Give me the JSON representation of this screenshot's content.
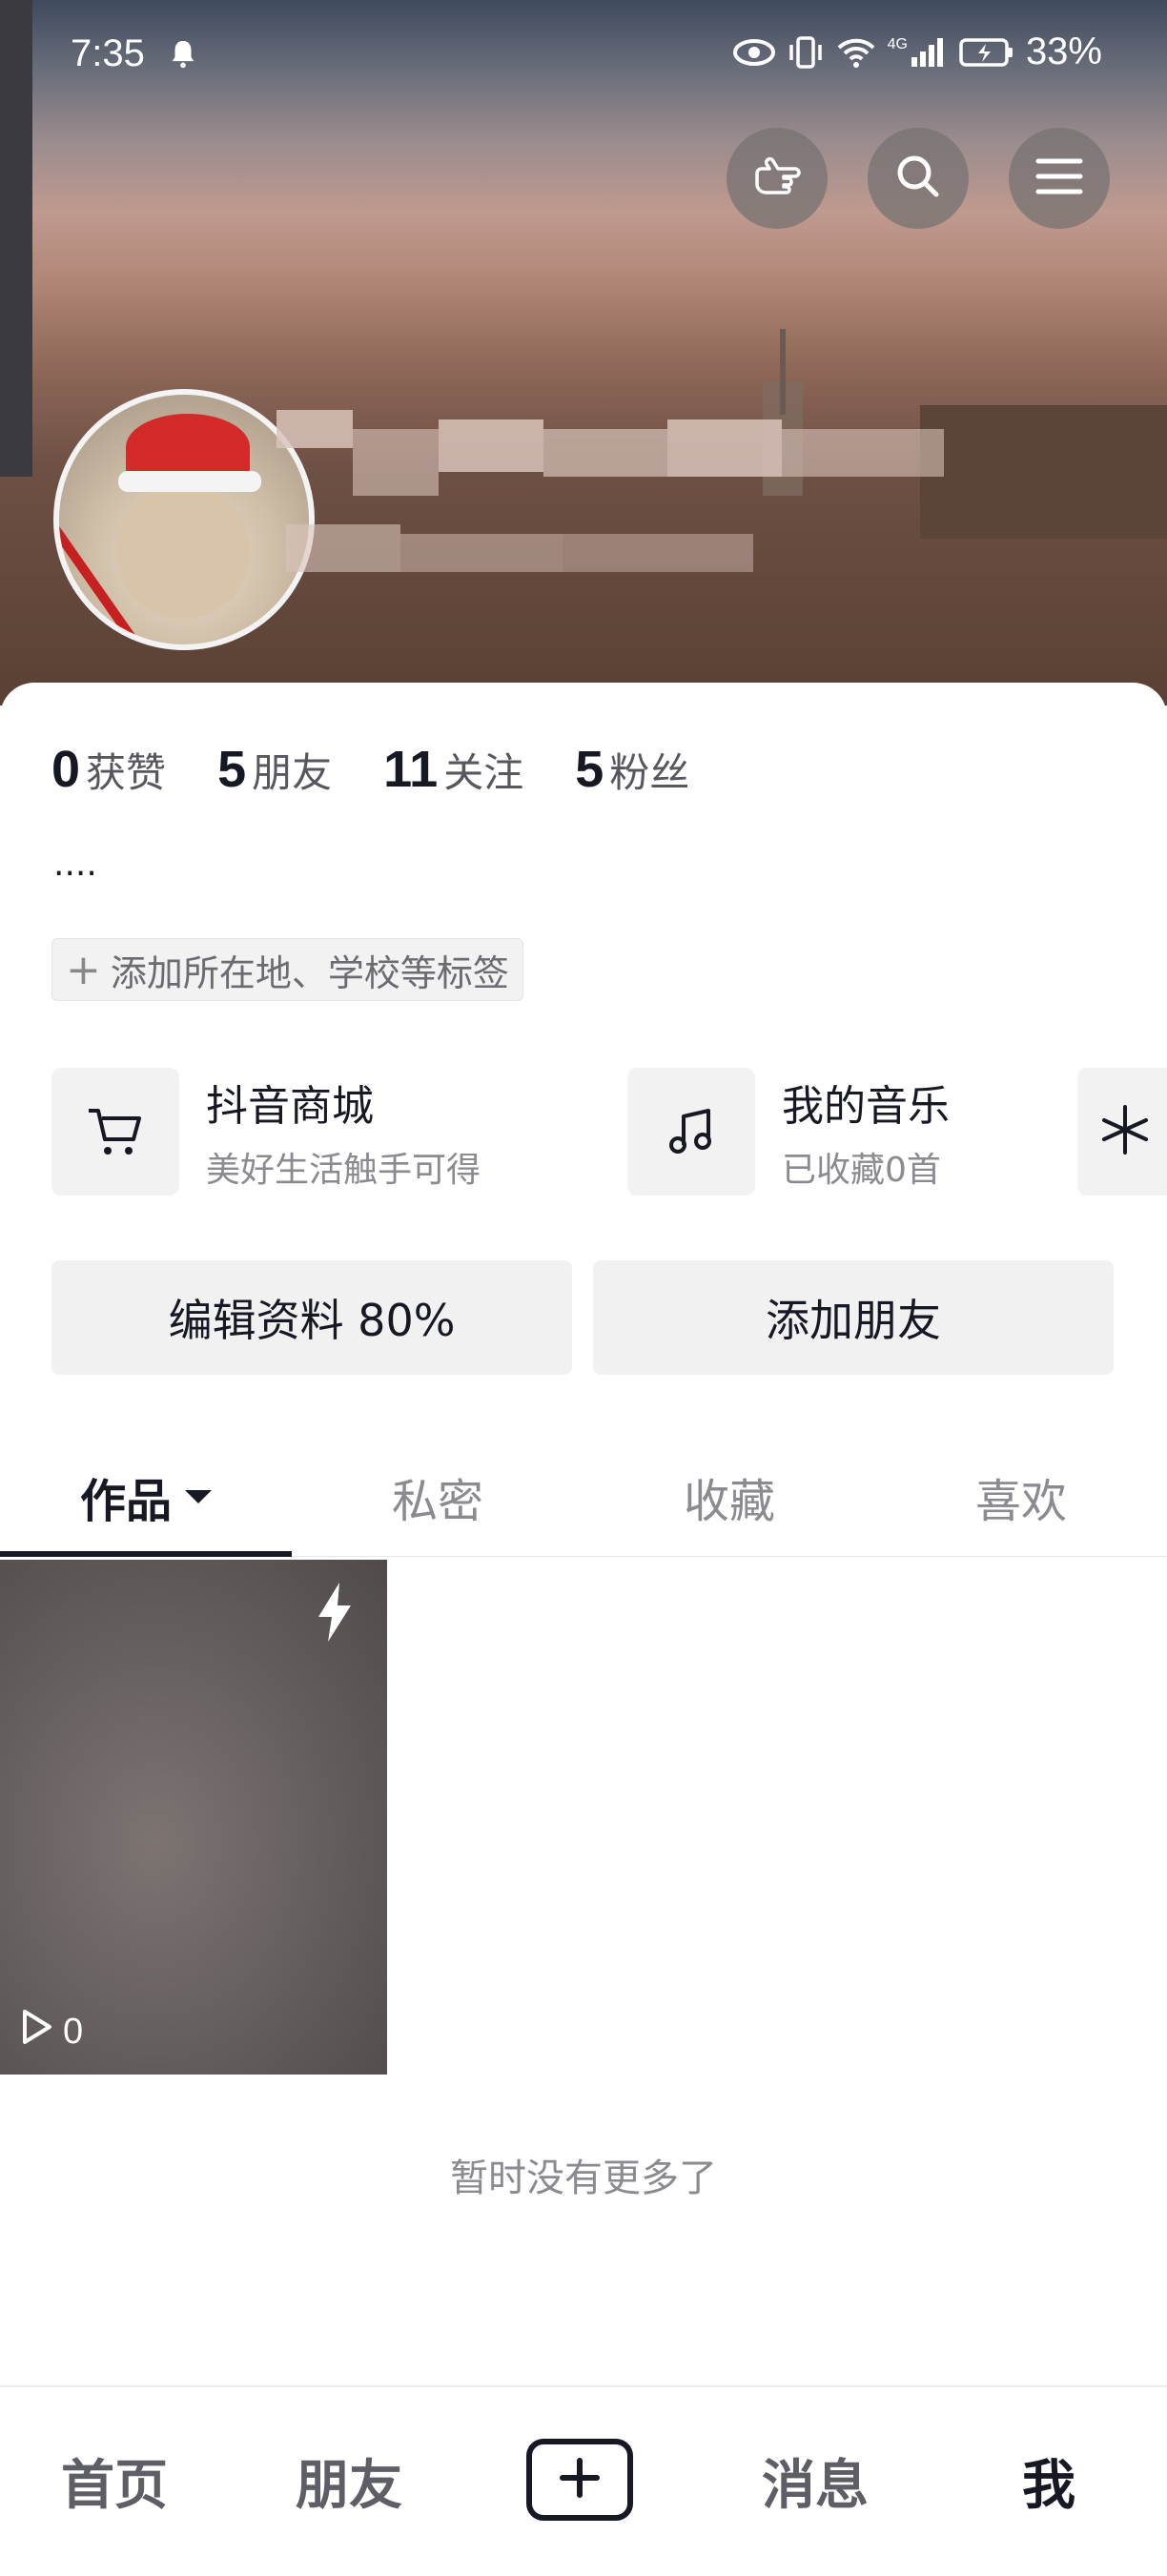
{
  "status_bar": {
    "time": "7:35",
    "network": "4G",
    "battery": "33%"
  },
  "header_actions": [
    {
      "name": "hand-pointer-icon"
    },
    {
      "name": "search-icon"
    },
    {
      "name": "menu-icon"
    }
  ],
  "profile": {
    "stats": [
      {
        "num": "0",
        "label": "获赞"
      },
      {
        "num": "5",
        "label": "朋友"
      },
      {
        "num": "11",
        "label": "关注"
      },
      {
        "num": "5",
        "label": "粉丝"
      }
    ],
    "bio": "....",
    "add_tag": "添加所在地、学校等标签"
  },
  "services": {
    "shop": {
      "title": "抖音商城",
      "sub": "美好生活触手可得"
    },
    "music": {
      "title": "我的音乐",
      "sub": "已收藏0首"
    }
  },
  "buttons": {
    "edit_profile": "编辑资料 80%",
    "add_friends": "添加朋友"
  },
  "tabs": [
    "作品",
    "私密",
    "收藏",
    "喜欢"
  ],
  "works": [
    {
      "plays": "0"
    }
  ],
  "end_text": "暂时没有更多了",
  "bottom_nav": {
    "home": "首页",
    "friends": "朋友",
    "messages": "消息",
    "me": "我"
  },
  "colors": {
    "text_primary": "#161823",
    "text_secondary": "#8a8a90",
    "chip_bg": "#f2f2f2"
  }
}
